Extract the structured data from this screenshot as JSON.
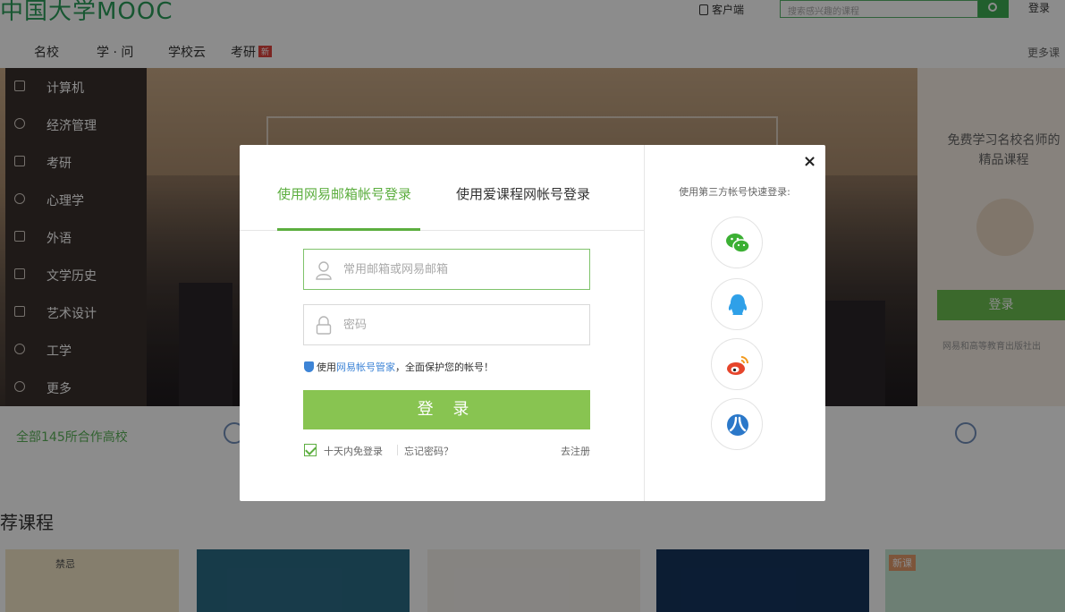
{
  "topbar": {
    "logo": "中国大学MOOC",
    "client": "客户端",
    "search_placeholder": "搜索感兴趣的课程",
    "login": "登录"
  },
  "nav": {
    "items": [
      "名校",
      "学 · 问",
      "学校云",
      "考研"
    ],
    "new_badge": "新",
    "more": "更多课"
  },
  "sidebar": {
    "items": [
      {
        "label": "计算机",
        "icon": "monitor-icon"
      },
      {
        "label": "经济管理",
        "icon": "coin-icon"
      },
      {
        "label": "考研",
        "icon": "pencil-icon"
      },
      {
        "label": "心理学",
        "icon": "heart-icon"
      },
      {
        "label": "外语",
        "icon": "chat-icon"
      },
      {
        "label": "文学历史",
        "icon": "book-icon"
      },
      {
        "label": "艺术设计",
        "icon": "picture-icon"
      },
      {
        "label": "工学",
        "icon": "bulb-icon"
      },
      {
        "label": "更多",
        "icon": "more-icon"
      }
    ]
  },
  "side_panel": {
    "title": "免费学习名校名师的精品课程",
    "login": "登录",
    "note": "网易和高等教育出版社出"
  },
  "partners": {
    "label": "全部145所合作高校"
  },
  "section": {
    "title": "荐课程"
  },
  "cards": {
    "card1_text": "禁忌",
    "card5_badge": "新课"
  },
  "modal": {
    "tab_email": "使用网易邮箱帐号登录",
    "tab_icourse": "使用爱课程网帐号登录",
    "email_placeholder": "常用邮箱或网易邮箱",
    "password_placeholder": "密码",
    "guard_prefix": "使用",
    "guard_link": "网易帐号管家",
    "guard_suffix": "，全面保护您的帐号！",
    "login_button": "登 录",
    "remember": "十天内免登录",
    "forgot": "忘记密码？",
    "register": "去注册",
    "close": "×",
    "third_party_title": "使用第三方帐号快速登录:",
    "social": [
      "wechat-icon",
      "qq-icon",
      "weibo-icon",
      "renren-icon"
    ]
  },
  "colors": {
    "accent_green": "#5cae3f",
    "login_button": "#88c451",
    "link_blue": "#3d84d6",
    "wechat": "#3cb034",
    "qq": "#2fa0e8",
    "weibo": "#e6452b",
    "renren": "#2b78c9"
  }
}
